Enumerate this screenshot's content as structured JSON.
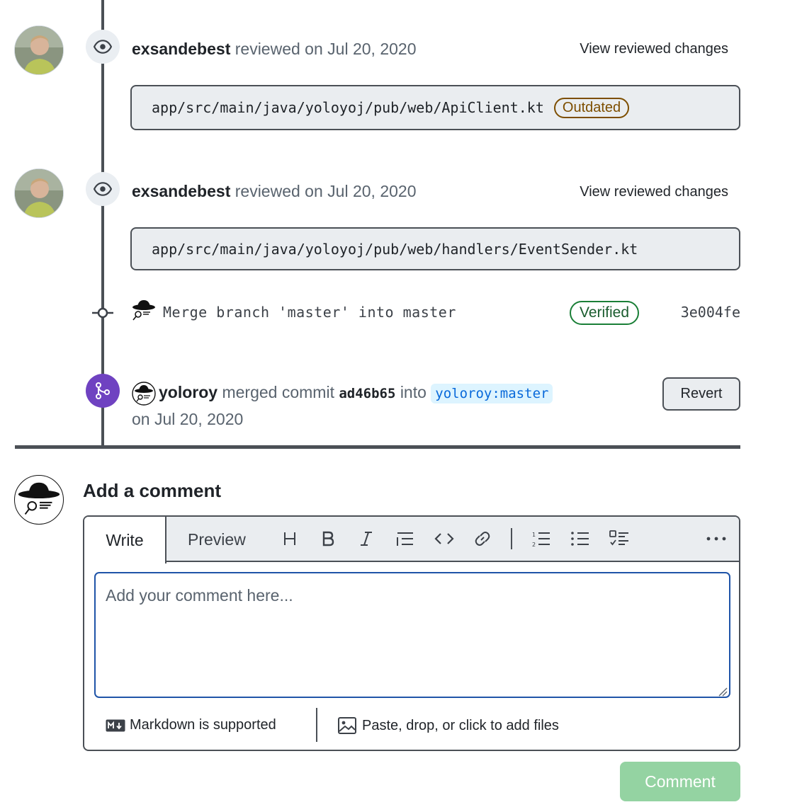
{
  "timeline": {
    "reviews": [
      {
        "user": "exsandebest",
        "action": "reviewed on Jul 20, 2020",
        "link": "View reviewed changes",
        "file": "app/src/main/java/yoloyoj/pub/web/ApiClient.kt",
        "badge": "Outdated"
      },
      {
        "user": "exsandebest",
        "action": "reviewed on Jul 20, 2020",
        "link": "View reviewed changes",
        "file": "app/src/main/java/yoloyoj/pub/web/handlers/EventSender.kt"
      }
    ],
    "commit": {
      "message": "Merge branch 'master' into master",
      "verified": "Verified",
      "sha": "3e004fe"
    },
    "merge": {
      "user": "yoloroy",
      "text_merged": "merged commit",
      "commit_sha": "ad46b65",
      "text_into": "into",
      "branch": "yoloroy:master",
      "date": "on Jul 20, 2020",
      "revert_label": "Revert"
    }
  },
  "comment_box": {
    "title": "Add a comment",
    "tabs": [
      "Write",
      "Preview"
    ],
    "placeholder": "Add your comment here...",
    "markdown_note": "Markdown is supported",
    "attach_note": "Paste, drop, or click to add files",
    "submit_label": "Comment",
    "toolbar_icons": [
      "heading-icon",
      "bold-icon",
      "italic-icon",
      "quote-icon",
      "code-icon",
      "link-icon",
      "ordered-list-icon",
      "unordered-list-icon",
      "task-list-icon",
      "more-icon"
    ]
  },
  "colors": {
    "merged_purple": "#6f42c1",
    "verified_green": "#1a7f37",
    "outdated_brown": "#7d4e00",
    "comment_button": "#94d3a2",
    "branch_blue": "#0969da"
  }
}
